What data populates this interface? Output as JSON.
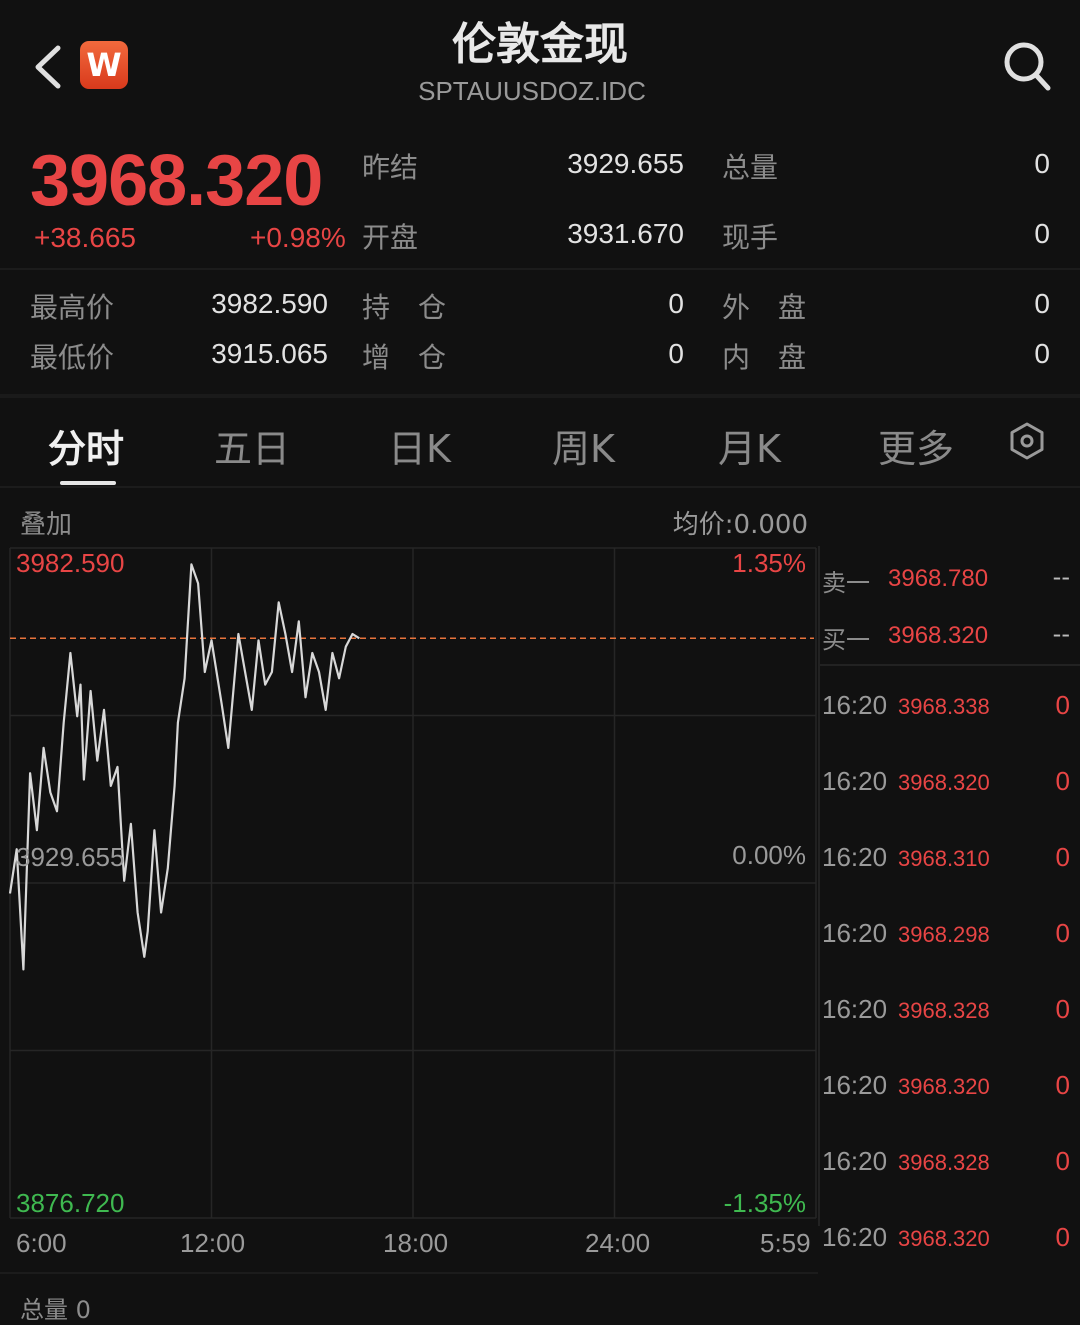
{
  "header": {
    "title": "伦敦金现",
    "subtitle": "SPTAUUSDOZ.IDC",
    "logo_letter": "W",
    "icons": {
      "back": "chevron-left-icon",
      "search": "search-icon",
      "settings": "settings-icon"
    }
  },
  "quote": {
    "price": "3968.320",
    "change": "+38.665",
    "change_pct": "+0.98%",
    "fields": [
      {
        "label": "昨结",
        "value": "3929.655"
      },
      {
        "label": "开盘",
        "value": "3931.670"
      },
      {
        "label": "总量",
        "value": "0"
      },
      {
        "label": "现手",
        "value": "0"
      },
      {
        "label": "最高价",
        "value": "3982.590"
      },
      {
        "label": "最低价",
        "value": "3915.065"
      },
      {
        "label": "持　仓",
        "value": "0"
      },
      {
        "label": "增　仓",
        "value": "0"
      },
      {
        "label": "外　盘",
        "value": "0"
      },
      {
        "label": "内　盘",
        "value": "0"
      }
    ]
  },
  "tabs": [
    {
      "label": "分时",
      "active": true
    },
    {
      "label": "五日"
    },
    {
      "label": "日K"
    },
    {
      "label": "周K"
    },
    {
      "label": "月K"
    },
    {
      "label": "更多"
    }
  ],
  "chart_labels": {
    "overlay": "叠加",
    "avg_price": "均价:0.000",
    "high": "3982.590",
    "high_pct": "1.35%",
    "mid": "3929.655",
    "mid_pct": "0.00%",
    "low": "3876.720",
    "low_pct": "-1.35%",
    "times": [
      "6:00",
      "12:00",
      "18:00",
      "24:00",
      "5:59"
    ],
    "footer": "总量 0"
  },
  "order_book": [
    {
      "label": "卖一",
      "price": "3968.780",
      "volume": "--"
    },
    {
      "label": "买一",
      "price": "3968.320",
      "volume": "--"
    }
  ],
  "ticks": [
    {
      "time": "16:20",
      "price": "3968.338",
      "volume": "0"
    },
    {
      "time": "16:20",
      "price": "3968.320",
      "volume": "0"
    },
    {
      "time": "16:20",
      "price": "3968.310",
      "volume": "0"
    },
    {
      "time": "16:20",
      "price": "3968.298",
      "volume": "0"
    },
    {
      "time": "16:20",
      "price": "3968.328",
      "volume": "0"
    },
    {
      "time": "16:20",
      "price": "3968.320",
      "volume": "0"
    },
    {
      "time": "16:20",
      "price": "3968.328",
      "volume": "0"
    },
    {
      "time": "16:20",
      "price": "3968.320",
      "volume": "0"
    }
  ],
  "chart_data": {
    "type": "line",
    "title": "",
    "x_labels": [
      "6:00",
      "12:00",
      "18:00",
      "24:00",
      "5:59"
    ],
    "ylim": [
      3876.72,
      3982.59
    ],
    "reference": 3929.655,
    "current": 3968.32,
    "series": [
      {
        "x_hours": [
          0.0,
          0.2,
          0.4,
          0.6,
          0.8,
          1.0,
          1.2,
          1.4,
          1.6,
          1.8,
          2.0,
          2.1,
          2.2,
          2.4,
          2.6,
          2.8,
          3.0,
          3.2,
          3.4,
          3.6,
          3.8,
          4.0,
          4.1,
          4.3,
          4.5,
          4.7,
          4.9,
          5.0,
          5.2,
          5.4,
          5.6,
          5.8,
          6.0,
          6.3,
          6.5,
          6.8,
          7.0,
          7.2,
          7.4,
          7.6,
          7.8,
          8.0,
          8.2,
          8.4,
          8.6,
          8.8,
          9.0,
          9.2,
          9.4,
          9.6,
          9.8,
          10.0,
          10.2,
          10.4
        ],
        "values": [
          3928,
          3935,
          3916,
          3947,
          3938,
          3951,
          3944,
          3941,
          3955,
          3966,
          3956,
          3961,
          3946,
          3960,
          3949,
          3957,
          3945,
          3948,
          3930,
          3939,
          3925,
          3918,
          3922,
          3938,
          3925,
          3932,
          3945,
          3955,
          3962,
          3980,
          3977,
          3963,
          3968,
          3958,
          3951,
          3969,
          3963,
          3957,
          3968,
          3961,
          3963,
          3974,
          3969,
          3963,
          3971,
          3959,
          3966,
          3963,
          3957,
          3966,
          3962,
          3967,
          3969,
          3968.32
        ]
      }
    ]
  }
}
